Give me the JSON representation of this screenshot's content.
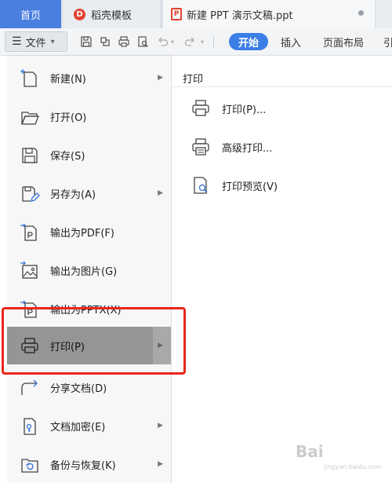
{
  "tabs": {
    "home": "首页",
    "docer": "稻壳模板",
    "document": "新建 PPT 演示文稿.ppt"
  },
  "toolbar": {
    "file_label": "文件",
    "ribbon_tabs": [
      "开始",
      "插入",
      "页面布局",
      "引"
    ]
  },
  "file_menu": {
    "items": [
      {
        "label": "新建(N)",
        "icon": "new-file-icon",
        "has_submenu": true
      },
      {
        "label": "打开(O)",
        "icon": "folder-open-icon",
        "has_submenu": false
      },
      {
        "label": "保存(S)",
        "icon": "save-icon",
        "has_submenu": false
      },
      {
        "label": "另存为(A)",
        "icon": "save-as-icon",
        "has_submenu": true
      },
      {
        "label": "输出为PDF(F)",
        "icon": "export-pdf-icon",
        "has_submenu": false
      },
      {
        "label": "输出为图片(G)",
        "icon": "export-image-icon",
        "has_submenu": false
      },
      {
        "label": "输出为PPTX(X)",
        "icon": "export-pptx-icon",
        "has_submenu": false
      },
      {
        "label": "打印(P)",
        "icon": "printer-icon",
        "has_submenu": true,
        "selected": true
      },
      {
        "label": "分享文档(D)",
        "icon": "share-icon",
        "has_submenu": false
      },
      {
        "label": "文档加密(E)",
        "icon": "encrypt-icon",
        "has_submenu": true
      },
      {
        "label": "备份与恢复(K)",
        "icon": "backup-icon",
        "has_submenu": true
      }
    ]
  },
  "print_panel": {
    "title": "打印",
    "items": [
      {
        "label": "打印(P)...",
        "icon": "printer-icon"
      },
      {
        "label": "高级打印...",
        "icon": "advanced-print-icon"
      },
      {
        "label": "打印预览(V)",
        "icon": "print-preview-icon"
      }
    ]
  },
  "watermark": {
    "text": "Bai",
    "sub": "jingyan.baidu.com"
  },
  "colors": {
    "accent": "#3b7ee6",
    "highlight": "#e8271c",
    "selected_bg": "#959595",
    "icon_blue": "#2f6fd6"
  }
}
